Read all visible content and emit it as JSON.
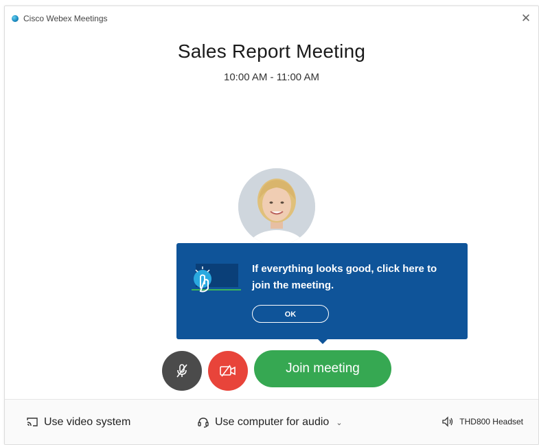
{
  "titlebar": {
    "app_name": "Cisco Webex Meetings",
    "logo_icon": "webex-logo-icon",
    "close_icon": "close-icon",
    "close_glyph": "✕"
  },
  "meeting": {
    "title": "Sales Report Meeting",
    "time": "10:00 AM - 11:00 AM"
  },
  "tooltip": {
    "text": "If everything looks good, click here to join the meeting.",
    "ok_label": "OK",
    "illustration_icon": "click-hand-icon"
  },
  "controls": {
    "mute_icon": "microphone-muted-icon",
    "video_icon": "video-off-icon",
    "join_label": "Join meeting"
  },
  "bottom_bar": {
    "video_system_label": "Use video system",
    "audio_label": "Use computer for audio",
    "audio_dropdown_glyph": "⌄",
    "speaker_label": "THD800 Headset"
  },
  "colors": {
    "tooltip_bg": "#0f5499",
    "join_green": "#36a852",
    "video_red": "#e8443a",
    "mute_gray": "#4b4b4b"
  }
}
